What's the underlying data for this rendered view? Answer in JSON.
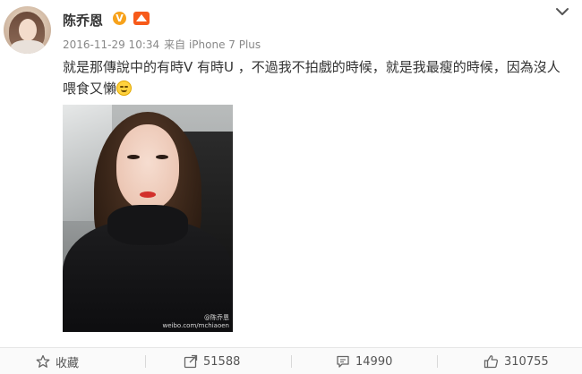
{
  "post": {
    "username": "陈乔恩",
    "verified_badge": "V",
    "timestamp": "2016-11-29 10:34",
    "source": "来自 iPhone 7 Plus",
    "text": "就是那傳說中的有時V 有時U ，不過我不拍戲的時候，就是我最瘦的時候，因為沒人喂食又懶",
    "emoji": "laughing-sweat-emoji",
    "image_watermark_line1": "@陈乔恩",
    "image_watermark_line2": "weibo.com/mchiaoen"
  },
  "actions": {
    "favorite_label": "收藏",
    "repost_count": "51588",
    "comment_count": "14990",
    "like_count": "310755"
  },
  "icons": {
    "menu": "chevron-down-icon",
    "favorite": "star-icon",
    "repost": "share-arrow-icon",
    "comment": "comment-icon",
    "like": "thumbs-up-icon"
  },
  "colors": {
    "verified_badge": "#f7a21b",
    "member_badge": "#f75a1a",
    "meta_text": "#888888"
  }
}
